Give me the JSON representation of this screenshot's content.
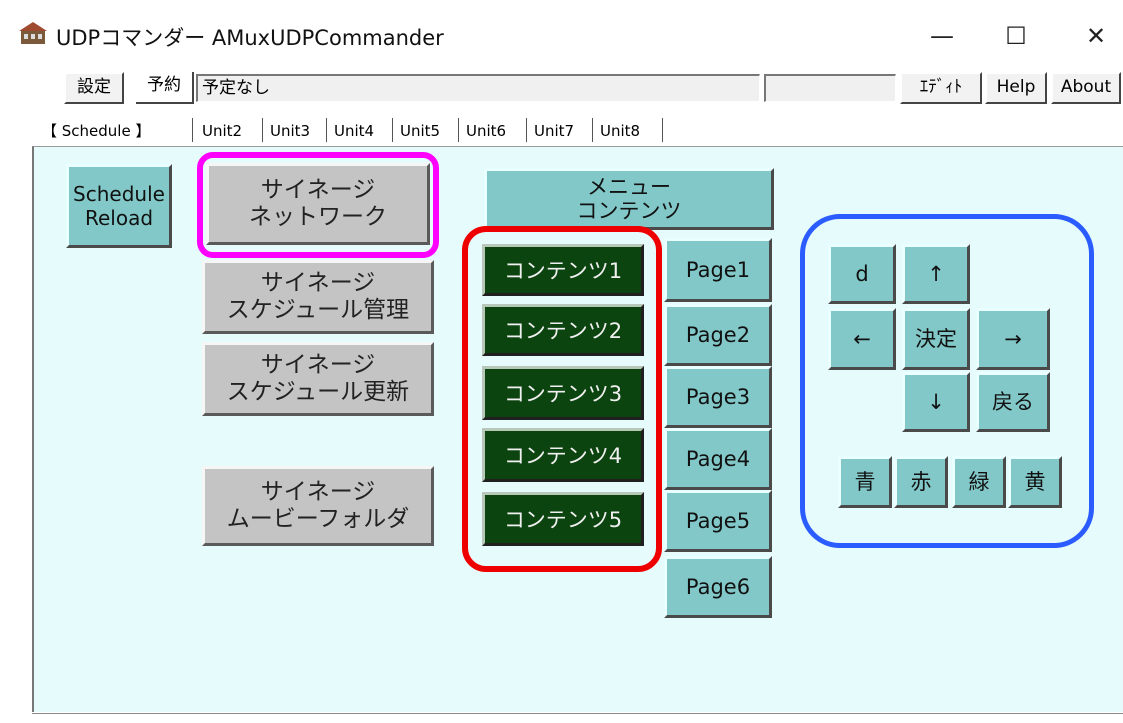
{
  "window": {
    "title": "UDPコマンダー AMuxUDPCommander",
    "minimize_glyph": "—",
    "maximize_glyph": "☐",
    "close_glyph": "✕"
  },
  "toolbar": {
    "settings_label": "設定",
    "reserve_label": "予約",
    "status_text": "予定なし",
    "extra_field": "",
    "edit_label": "ｴﾃﾞｨﾄ",
    "help_label": "Help",
    "about_label": "About"
  },
  "tabs": [
    "【 Schedule 】",
    "Unit2",
    "Unit3",
    "Unit4",
    "Unit5",
    "Unit6",
    "Unit7",
    "Unit8"
  ],
  "schedule_reload_label": "Schedule\nReload",
  "signage_buttons": {
    "network": "サイネージ\nネットワーク",
    "schedule_manage": "サイネージ\nスケジュール管理",
    "schedule_update": "サイネージ\nスケジュール更新",
    "movie_folder": "サイネージ\nムービーフォルダ"
  },
  "menu_contents_label": "メニュー\nコンテンツ",
  "contents": [
    "コンテンツ1",
    "コンテンツ2",
    "コンテンツ3",
    "コンテンツ4",
    "コンテンツ5"
  ],
  "pages": [
    "Page1",
    "Page2",
    "Page3",
    "Page4",
    "Page5",
    "Page6"
  ],
  "remote": {
    "d": "d",
    "up": "↑",
    "left": "←",
    "enter": "決定",
    "right": "→",
    "down": "↓",
    "back": "戻る",
    "blue": "青",
    "red": "赤",
    "green": "緑",
    "yellow": "黄"
  },
  "highlight_colors": {
    "signage_network": "#ff00ff",
    "contents_group": "#ee0000",
    "remote_group": "#2a5cff"
  }
}
